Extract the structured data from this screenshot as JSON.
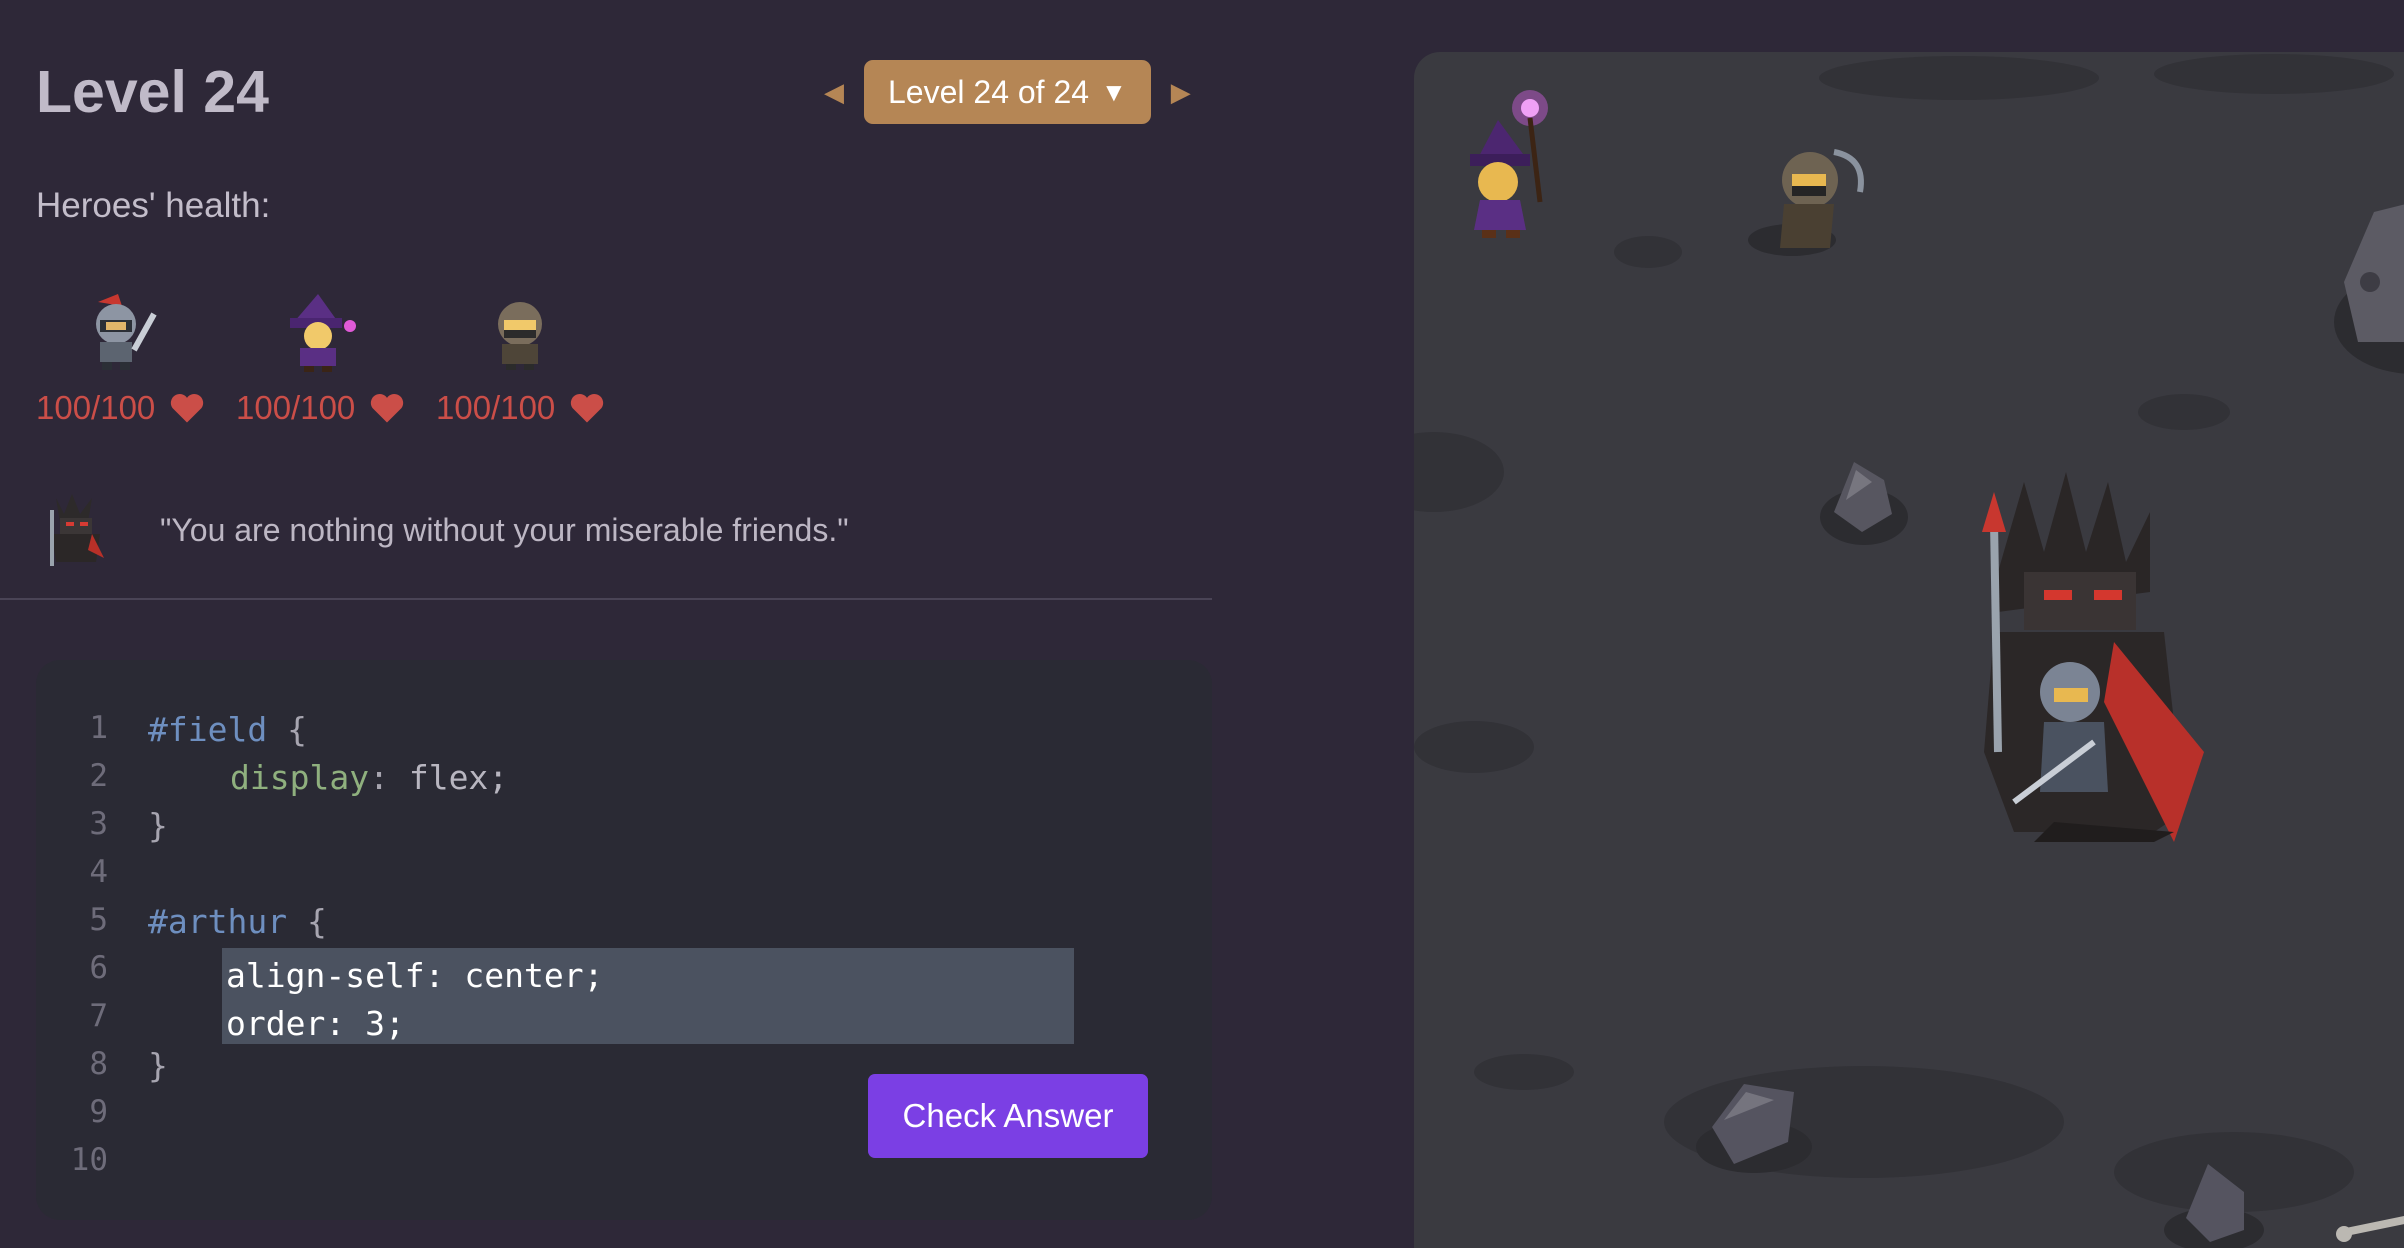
{
  "level": {
    "title": "Level 24",
    "selector_label": "Level 24 of 24"
  },
  "health": {
    "label": "Heroes' health:",
    "heroes": [
      {
        "name": "arthur",
        "hp": "100/100"
      },
      {
        "name": "wizard",
        "hp": "100/100"
      },
      {
        "name": "thief",
        "hp": "100/100"
      }
    ]
  },
  "enemy": {
    "quote": "\"You are nothing without your miserable friends.\""
  },
  "editor": {
    "line_numbers": [
      "1",
      "2",
      "3",
      "4",
      "5",
      "6",
      "7",
      "8",
      "9",
      "10"
    ],
    "field_selector": "#field",
    "open_brace": "{",
    "close_brace": "}",
    "display_prop": "display",
    "display_value": "flex;",
    "colon": ":",
    "arthur_selector": "#arthur",
    "input_value": "align-self: center;\norder: 3;",
    "check_button": "Check Answer"
  },
  "colors": {
    "accent": "#b58655",
    "button": "#7b3fe4",
    "health": "#cb4e48",
    "background": "#2e2838"
  }
}
